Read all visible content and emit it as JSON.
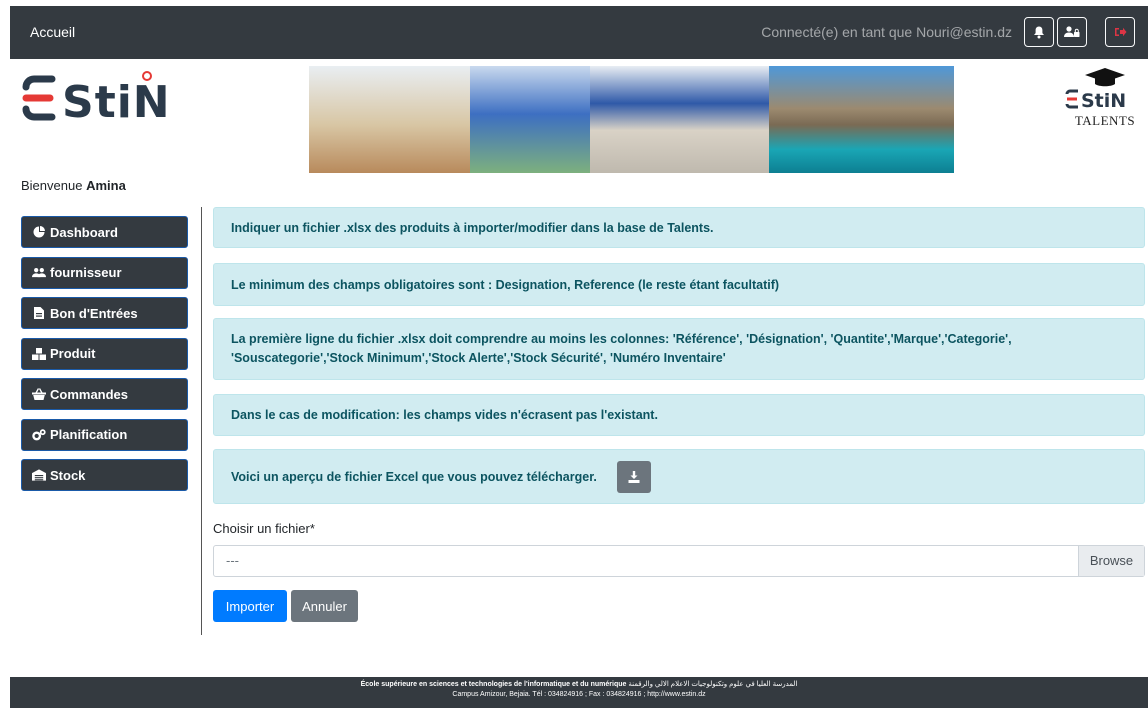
{
  "topbar": {
    "home_label": "Accueil",
    "user_text": "Connecté(e) en tant que Nouri@estin.dz"
  },
  "logo": {
    "text": "ESTIN",
    "right_sub": "TALENTS"
  },
  "welcome": {
    "prefix": "Bienvenue ",
    "name": "Amina"
  },
  "sidebar": {
    "items": [
      {
        "label": "Dashboard",
        "icon": "pie-chart-icon"
      },
      {
        "label": "fournisseur",
        "icon": "users-icon"
      },
      {
        "label": "Bon d'Entrées",
        "icon": "file-invoice-icon"
      },
      {
        "label": "Produit",
        "icon": "boxes-icon"
      },
      {
        "label": "Commandes",
        "icon": "basket-icon"
      },
      {
        "label": "Planification",
        "icon": "cogs-icon"
      },
      {
        "label": "Stock",
        "icon": "warehouse-icon"
      }
    ]
  },
  "alerts": {
    "a1": "Indiquer un fichier .xlsx des produits à importer/modifier dans la base de Talents.",
    "a2": "Le minimum des champs obligatoires sont : Designation, Reference (le reste étant facultatif)",
    "a3_line1": "La première ligne du fichier .xlsx doit comprendre au moins les colonnes: 'Référence', 'Désignation', 'Quantite','Marque','Categorie',",
    "a3_line2": "'Souscategorie','Stock Minimum','Stock Alerte','Stock Sécurité', 'Numéro Inventaire'",
    "a4": "Dans le cas de modification: les champs vides n'écrasent pas l'existant.",
    "a5": "Voici un aperçu de fichier Excel que vous pouvez télécharger."
  },
  "form": {
    "file_label": "Choisir un fichier*",
    "file_value": "---",
    "browse_label": "Browse",
    "import_label": "Importer",
    "cancel_label": "Annuler"
  },
  "footer": {
    "line1_fr": "École supérieure en sciences et technologies de l'informatique et du numérique",
    "line1_ar": "المدرسة العليا في علوم وتكنولوجيات الاعلام الالي والرقمنة",
    "line2": "Campus Amizour, Bejaia. Tél : 034824916 ; Fax : 034824916 ; http://www.estin.dz"
  },
  "colors": {
    "topbar": "#343a40",
    "alert_bg": "#d1ecf1",
    "alert_text": "#0c5460",
    "primary": "#007bff",
    "secondary": "#6c757d",
    "logo_red": "#e53935",
    "logo_dark": "#2b3a4a"
  }
}
